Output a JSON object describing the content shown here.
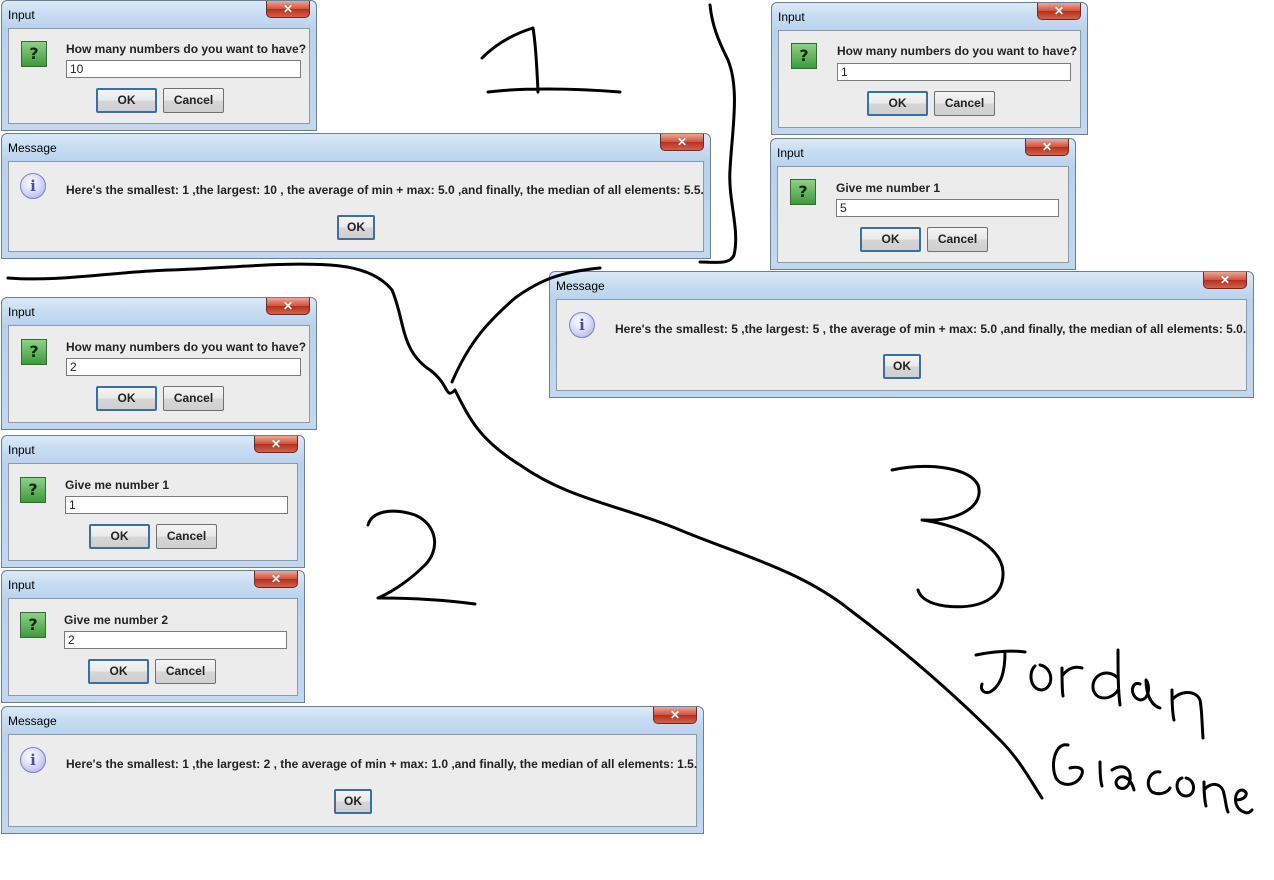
{
  "dialogs": {
    "d1_input_count": {
      "title": "Input",
      "close": "✕",
      "prompt": "How many numbers do you want to have?",
      "value": "10",
      "ok": "OK",
      "cancel": "Cancel"
    },
    "d1_message": {
      "title": "Message",
      "close": "✕",
      "text": "Here's the smallest: 1 ,the largest: 10 , the average of min + max: 5.0 ,and finally, the median of all elements: 5.5.",
      "ok": "OK"
    },
    "d3_input_count": {
      "title": "Input",
      "close": "✕",
      "prompt": "How many numbers do you want to have?",
      "value": "1",
      "ok": "OK",
      "cancel": "Cancel"
    },
    "d3_input_num1": {
      "title": "Input",
      "close": "✕",
      "prompt": "Give me number 1",
      "value": "5",
      "ok": "OK",
      "cancel": "Cancel"
    },
    "d3_message": {
      "title": "Message",
      "close": "✕",
      "text": "Here's the smallest: 5 ,the largest: 5 , the average of min + max: 5.0 ,and finally, the median of all elements: 5.0.",
      "ok": "OK"
    },
    "d2_input_count": {
      "title": "Input",
      "close": "✕",
      "prompt": "How many numbers do you want to have?",
      "value": "2",
      "ok": "OK",
      "cancel": "Cancel"
    },
    "d2_input_num1": {
      "title": "Input",
      "close": "✕",
      "prompt": "Give me number 1",
      "value": "1",
      "ok": "OK",
      "cancel": "Cancel"
    },
    "d2_input_num2": {
      "title": "Input",
      "close": "✕",
      "prompt": "Give me number 2",
      "value": "2",
      "ok": "OK",
      "cancel": "Cancel"
    },
    "d2_message": {
      "title": "Message",
      "close": "✕",
      "text": "Here's the smallest: 1 ,the largest: 2 , the average of min + max: 1.0 ,and finally, the median of all elements: 1.5.",
      "ok": "OK"
    }
  },
  "icons": {
    "question": "?",
    "info": "i"
  },
  "annotations": {
    "section_1": "1",
    "section_2": "2",
    "section_3": "3",
    "signature_first": "Jordan",
    "signature_last": "Giacone"
  },
  "colors": {
    "title_bar": "#c6dcf2",
    "close_button": "#c8402a",
    "question_icon": "#5cb85c",
    "info_icon": "#a8a8e6",
    "ink": "#000000"
  }
}
